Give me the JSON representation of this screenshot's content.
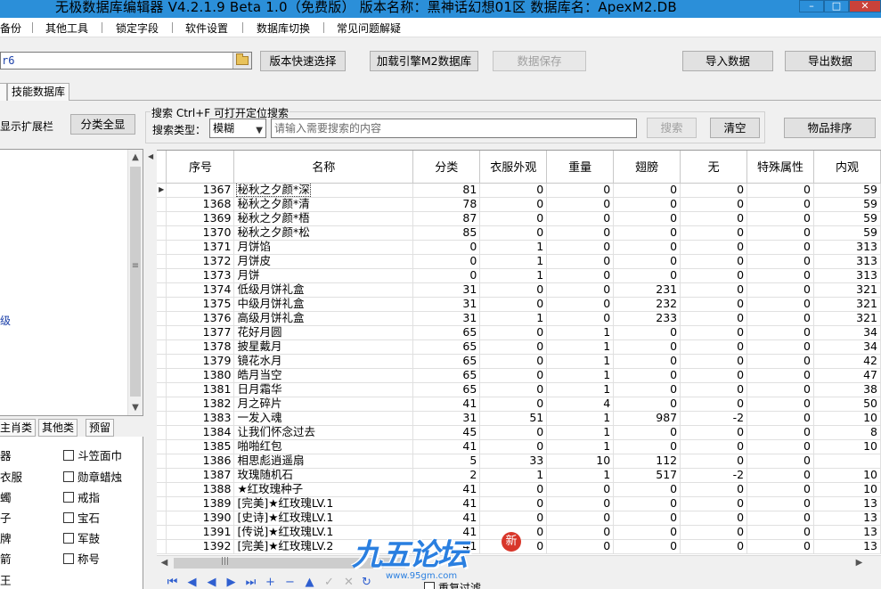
{
  "window": {
    "title": "无极数据库编辑器 V4.2.1.9    Beta 1.0（免费版）    版本名称：黑神话幻想01区    数据库名：ApexM2.DB"
  },
  "menu": [
    "备份",
    "其他工具",
    "锁定字段",
    "软件设置",
    "数据库切换",
    "常见问题解疑"
  ],
  "toolbar": {
    "db_path_value": "r6",
    "quick_select": "版本快速选择",
    "load_m2": "加载引擎M2数据库",
    "save_data": "数据保存",
    "import_data": "导入数据",
    "export_data": "导出数据"
  },
  "tabs": [
    "",
    "技能数据库"
  ],
  "left": {
    "ext_label": "显示扩展栏",
    "expand_all": "分类全显",
    "tree_fragment": "级",
    "tabs": [
      "主肖类",
      "其他类",
      "预留"
    ],
    "checkbox_col1": [
      "器",
      "衣服",
      "蠋",
      "子",
      "牌",
      "箭",
      "王"
    ],
    "checkbox_col2": [
      "斗笠面巾",
      "勋章蜡烛",
      "戒指",
      "宝石",
      "军鼓",
      "称号"
    ]
  },
  "search": {
    "title": "搜索  Ctrl+F 可打开定位搜索",
    "type_label": "搜索类型：",
    "type_value": "模糊",
    "placeholder": "请输入需要搜索的内容",
    "search_button": "搜索",
    "clear_button": "清空",
    "sort_button": "物品排序"
  },
  "table": {
    "columns": [
      "序号",
      "名称",
      "分类",
      "衣服外观",
      "重量",
      "翅膀",
      "无",
      "特殊属性",
      "内观"
    ],
    "rows": [
      [
        "1367",
        "秘秋之夕颜*深",
        "81",
        "0",
        "0",
        "0",
        "0",
        "0",
        "59"
      ],
      [
        "1368",
        "秘秋之夕颜*清",
        "78",
        "0",
        "0",
        "0",
        "0",
        "0",
        "59"
      ],
      [
        "1369",
        "秘秋之夕颜*梧",
        "87",
        "0",
        "0",
        "0",
        "0",
        "0",
        "59"
      ],
      [
        "1370",
        "秘秋之夕颜*松",
        "85",
        "0",
        "0",
        "0",
        "0",
        "0",
        "59"
      ],
      [
        "1371",
        "月饼馅",
        "0",
        "1",
        "0",
        "0",
        "0",
        "0",
        "313"
      ],
      [
        "1372",
        "月饼皮",
        "0",
        "1",
        "0",
        "0",
        "0",
        "0",
        "313"
      ],
      [
        "1373",
        "月饼",
        "0",
        "1",
        "0",
        "0",
        "0",
        "0",
        "313"
      ],
      [
        "1374",
        "低级月饼礼盒",
        "31",
        "0",
        "0",
        "231",
        "0",
        "0",
        "321"
      ],
      [
        "1375",
        "中级月饼礼盒",
        "31",
        "0",
        "0",
        "232",
        "0",
        "0",
        "321"
      ],
      [
        "1376",
        "高级月饼礼盒",
        "31",
        "1",
        "0",
        "233",
        "0",
        "0",
        "321"
      ],
      [
        "1377",
        "花好月圆",
        "65",
        "0",
        "1",
        "0",
        "0",
        "0",
        "34"
      ],
      [
        "1378",
        "披星戴月",
        "65",
        "0",
        "1",
        "0",
        "0",
        "0",
        "34"
      ],
      [
        "1379",
        "镜花水月",
        "65",
        "0",
        "1",
        "0",
        "0",
        "0",
        "42"
      ],
      [
        "1380",
        "皓月当空",
        "65",
        "0",
        "1",
        "0",
        "0",
        "0",
        "47"
      ],
      [
        "1381",
        "日月霜华",
        "65",
        "0",
        "1",
        "0",
        "0",
        "0",
        "38"
      ],
      [
        "1382",
        "月之碎片",
        "41",
        "0",
        "4",
        "0",
        "0",
        "0",
        "50"
      ],
      [
        "1383",
        "一发入魂",
        "31",
        "51",
        "1",
        "987",
        "-2",
        "0",
        "10"
      ],
      [
        "1384",
        "让我们怀念过去",
        "45",
        "0",
        "1",
        "0",
        "0",
        "0",
        "8"
      ],
      [
        "1385",
        "啪啪红包",
        "41",
        "0",
        "1",
        "0",
        "0",
        "0",
        "10"
      ],
      [
        "1386",
        "相思彪逍遥扇",
        "5",
        "33",
        "10",
        "112",
        "0",
        "0",
        ""
      ],
      [
        "1387",
        "玫瑰随机石",
        "2",
        "1",
        "1",
        "517",
        "-2",
        "0",
        "10"
      ],
      [
        "1388",
        "★红玫瑰种子",
        "41",
        "0",
        "0",
        "0",
        "0",
        "0",
        "10"
      ],
      [
        "1389",
        "[完美]★红玫瑰LV.1",
        "41",
        "0",
        "0",
        "0",
        "0",
        "0",
        "13"
      ],
      [
        "1390",
        "[史诗]★红玫瑰LV.1",
        "41",
        "0",
        "0",
        "0",
        "0",
        "0",
        "13"
      ],
      [
        "1391",
        "[传说]★红玫瑰LV.1",
        "41",
        "0",
        "0",
        "0",
        "0",
        "0",
        "13"
      ],
      [
        "1392",
        "[完美]★红玫瑰LV.2",
        "41",
        "0",
        "0",
        "0",
        "0",
        "0",
        "13"
      ]
    ]
  },
  "nav": {
    "filter_label": "重复过滤"
  },
  "watermark": {
    "text": "九五论坛",
    "url": "www.95gm.com",
    "badge": "新"
  }
}
